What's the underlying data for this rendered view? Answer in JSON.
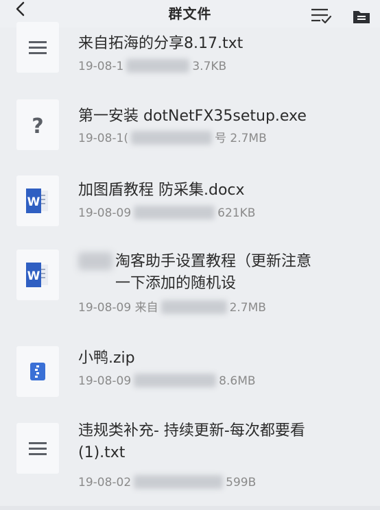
{
  "header": {
    "title": "群文件",
    "back_icon": "chevron-left-icon",
    "sort_icon": "sort-list-icon",
    "folder_icon": "folder-icon"
  },
  "files": [
    {
      "name": "来自拓海的分享8.17.txt",
      "date": "19-08-1",
      "size": "3.7KB",
      "icon": "text-file-icon"
    },
    {
      "name": "第一安装 dotNetFX35setup.exe",
      "date": "19-08-1(",
      "size": "号 2.7MB",
      "icon": "unknown-file-icon"
    },
    {
      "name": "加图盾教程 防采集.docx",
      "date": "19-08-09",
      "size": "621KB",
      "icon": "word-file-icon"
    },
    {
      "name": "淘客助手设置教程（更新注意一下添加的随机设",
      "date": "19-08-09 来自",
      "size": "2.7MB",
      "icon": "word-file-icon"
    },
    {
      "name": "小鸭.zip",
      "date": "19-08-09",
      "size": "8.6MB",
      "icon": "zip-file-icon"
    },
    {
      "name": "违规类补充- 持续更新-每次都要看 (1).txt",
      "date": "19-08-02",
      "size": "599B",
      "icon": "text-file-icon"
    }
  ],
  "colors": {
    "background": "#eceef1",
    "word_blue": "#2f5fc2",
    "zip_blue": "#3a70d6",
    "icon_gray": "#5b5f66"
  }
}
